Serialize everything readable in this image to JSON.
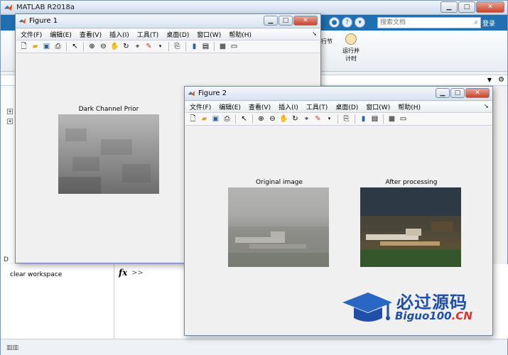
{
  "main_window": {
    "title": "MATLAB R2018a",
    "search_placeholder": "搜索文档",
    "login_label": "登录",
    "ribbon_run_section_label": "行节",
    "ribbon_run_time_label": "运行并计时",
    "history_title": "D",
    "history_items": [
      "clear workspace"
    ],
    "command_prompt": ">>"
  },
  "figure1": {
    "title": "Figure 1",
    "menu": [
      "文件(F)",
      "编辑(E)",
      "查看(V)",
      "插入(I)",
      "工具(T)",
      "桌面(D)",
      "窗口(W)",
      "帮助(H)"
    ],
    "axes_title": "Dark Channel Prior"
  },
  "figure2": {
    "title": "Figure 2",
    "menu": [
      "文件(F)",
      "编辑(E)",
      "查看(V)",
      "插入(I)",
      "工具(T)",
      "桌面(D)",
      "窗口(W)",
      "帮助(H)"
    ],
    "axes_titles": [
      "Original image",
      "After processing"
    ]
  },
  "toolbar_icons": [
    "new-figure-icon",
    "open-file-icon",
    "save-icon",
    "print-icon",
    "pointer-icon",
    "zoom-in-icon",
    "zoom-out-icon",
    "pan-icon",
    "rotate-icon",
    "data-cursor-icon",
    "brush-icon",
    "link-plot-icon",
    "colorbar-icon",
    "legend-icon",
    "hide-plot-tools-icon",
    "show-plot-tools-icon"
  ],
  "watermark": {
    "cn": "必过源码",
    "en_main": "Biguo100",
    "en_suffix": ".CN"
  },
  "colors": {
    "matlab_blue": "#1f6fb2",
    "watermark_blue": "#1f4fa8",
    "watermark_red": "#e03131"
  }
}
